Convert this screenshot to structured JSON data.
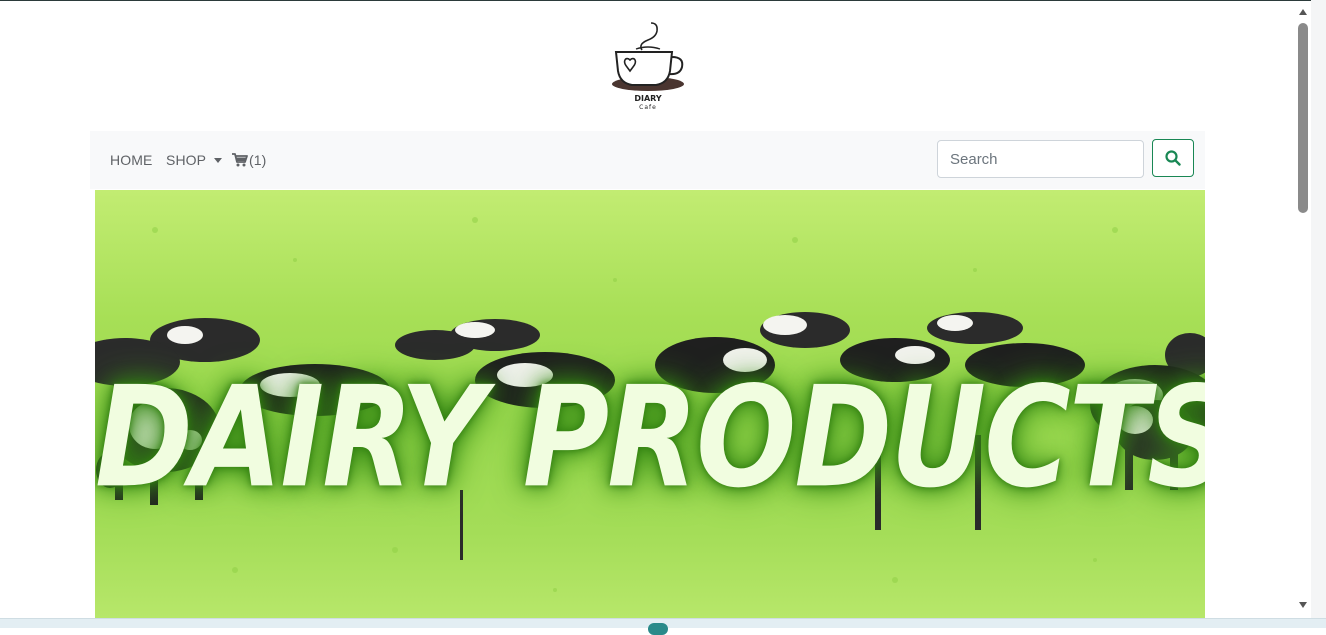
{
  "logo": {
    "brand": "DIARY",
    "sub": "Cafe",
    "icon": "coffee-cup-heart-icon"
  },
  "nav": {
    "home": "HOME",
    "shop": "SHOP",
    "cart_count": "(1)",
    "cart_icon": "cart-icon"
  },
  "search": {
    "placeholder": "Search",
    "value": "",
    "button_icon": "search-icon",
    "accent": "#198754"
  },
  "hero": {
    "title": "DAIRY PRODUCTS",
    "image": "cows-grazing-in-green-field"
  },
  "colors": {
    "navbar_bg": "#f8f9fa",
    "nav_text": "#5f6266",
    "hero_text": "#f1fde0",
    "hero_glow": "#3e9a18"
  }
}
